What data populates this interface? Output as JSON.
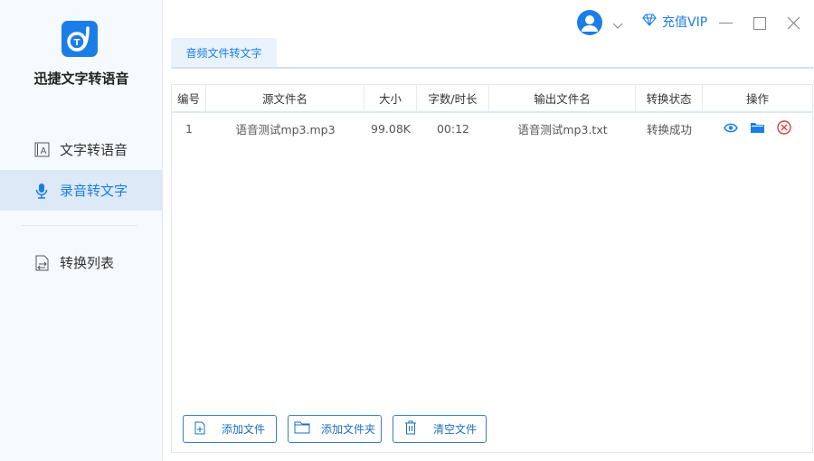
{
  "app": {
    "name": "迅捷文字转语音"
  },
  "sidebar": {
    "items": [
      {
        "label": "文字转语音",
        "icon": "text-a-icon"
      },
      {
        "label": "录音转文字",
        "icon": "microphone-icon",
        "active": true
      },
      {
        "label": "转换列表",
        "icon": "list-icon"
      }
    ]
  },
  "topbar": {
    "vip_label": "充值VIP"
  },
  "tabs": [
    {
      "label": "音频文件转文字",
      "active": true
    }
  ],
  "table": {
    "columns": [
      "编号",
      "源文件名",
      "大小",
      "字数/时长",
      "输出文件名",
      "转换状态",
      "操作"
    ],
    "rows": [
      {
        "index": "1",
        "source": "语音测试mp3.mp3",
        "size": "99.08K",
        "duration": "00:12",
        "output": "语音测试mp3.txt",
        "status": "转换成功"
      }
    ]
  },
  "buttons": {
    "add_file": "添加文件",
    "add_folder": "添加文件夹",
    "clear": "清空文件"
  },
  "colors": {
    "accent": "#1b7ee8",
    "danger": "#e03c3c"
  }
}
